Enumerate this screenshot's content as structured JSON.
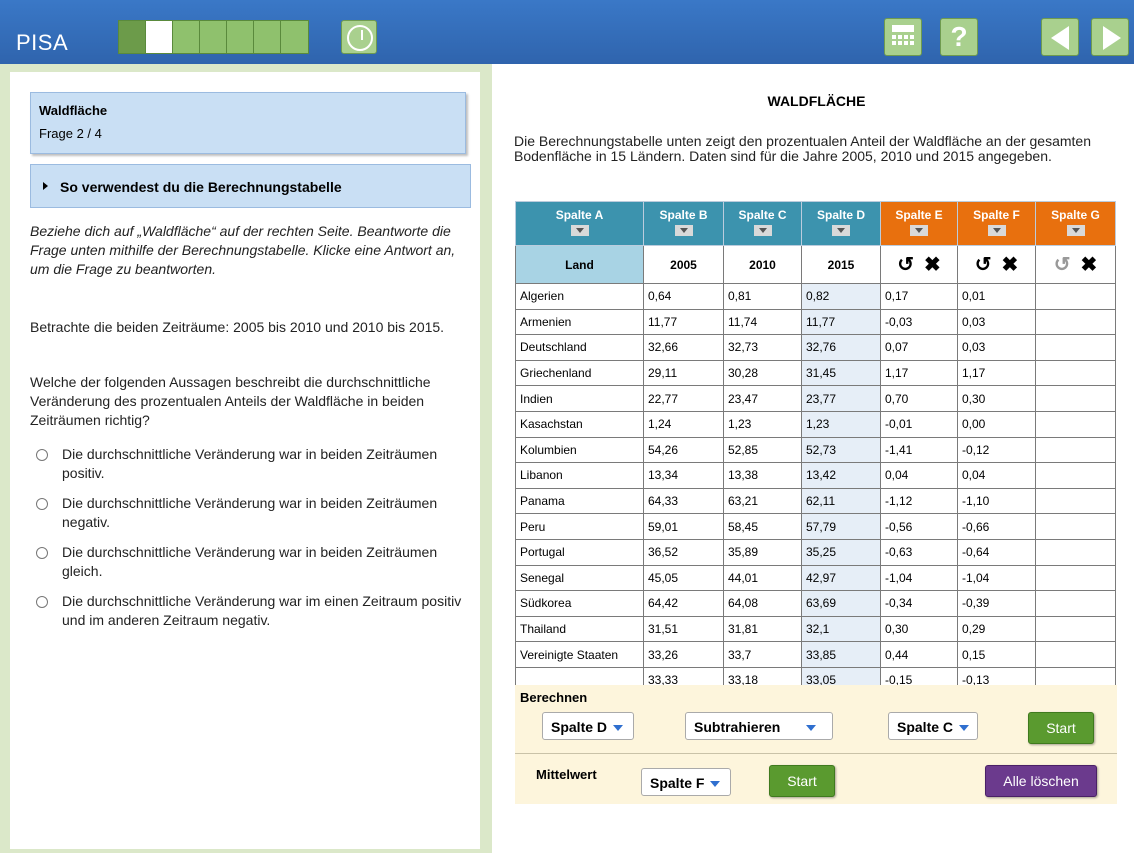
{
  "app": {
    "logo": "PISA"
  },
  "header": {
    "progress_total": 7,
    "progress_current": 2,
    "timer_icon": "clock-icon",
    "calculator_icon": "calculator-icon",
    "help_label": "?",
    "prev_icon": "arrow-left-icon",
    "next_icon": "arrow-right-icon"
  },
  "left": {
    "unit_title": "Waldfläche",
    "question_counter": "Frage 2 / 4",
    "howto_label": "So verwendest du die Berechnungstabelle",
    "instructions": "Beziehe dich auf „Waldfläche“ auf der rechten Seite. Beantworte die Frage unten mithilfe der Berechnungstabelle. Klicke eine Antwort an, um die Frage zu beantworten.",
    "context": "Betrachte die beiden Zeiträume: 2005 bis 2010 und 2010 bis 2015.",
    "question": "Welche der folgenden Aussagen beschreibt die durchschnittliche Veränderung des prozentualen Anteils der Waldfläche in beiden Zeiträumen richtig?",
    "options": [
      "Die durchschnittliche Veränderung war in beiden Zeiträumen positiv.",
      "Die durchschnittliche Veränderung war in beiden Zeiträumen negativ.",
      "Die durchschnittliche Veränderung war in beiden Zeiträumen gleich.",
      "Die durchschnittliche Veränderung war im einen Zeitraum positiv und im anderen Zeitraum negativ."
    ]
  },
  "right": {
    "title": "WALDFLÄCHE",
    "intro": "Die Berechnungstabelle unten zeigt den prozentualen Anteil der Waldfläche an der gesamten Bodenfläche in 15 Ländern. Daten sind für die Jahre 2005, 2010 und 2015 angegeben.",
    "columns": [
      "Spalte A",
      "Spalte B",
      "Spalte C",
      "Spalte D",
      "Spalte E",
      "Spalte F",
      "Spalte G"
    ],
    "subheaders": [
      "Land",
      "2005",
      "2010",
      "2015"
    ],
    "undo_icon": "↺",
    "clear_icon": "✖",
    "rows": [
      [
        "Algerien",
        "0,64",
        "0,81",
        "0,82",
        "0,17",
        "0,01",
        ""
      ],
      [
        "Armenien",
        "11,77",
        "11,74",
        "11,77",
        "-0,03",
        "0,03",
        ""
      ],
      [
        "Deutschland",
        "32,66",
        "32,73",
        "32,76",
        "0,07",
        "0,03",
        ""
      ],
      [
        "Griechenland",
        "29,11",
        "30,28",
        "31,45",
        "1,17",
        "1,17",
        ""
      ],
      [
        "Indien",
        "22,77",
        "23,47",
        "23,77",
        "0,70",
        "0,30",
        ""
      ],
      [
        "Kasachstan",
        "1,24",
        "1,23",
        "1,23",
        "-0,01",
        "0,00",
        ""
      ],
      [
        "Kolumbien",
        "54,26",
        "52,85",
        "52,73",
        "-1,41",
        "-0,12",
        ""
      ],
      [
        "Libanon",
        "13,34",
        "13,38",
        "13,42",
        "0,04",
        "0,04",
        ""
      ],
      [
        "Panama",
        "64,33",
        "63,21",
        "62,11",
        "-1,12",
        "-1,10",
        ""
      ],
      [
        "Peru",
        "59,01",
        "58,45",
        "57,79",
        "-0,56",
        "-0,66",
        ""
      ],
      [
        "Portugal",
        "36,52",
        "35,89",
        "35,25",
        "-0,63",
        "-0,64",
        ""
      ],
      [
        "Senegal",
        "45,05",
        "44,01",
        "42,97",
        "-1,04",
        "-1,04",
        ""
      ],
      [
        "Südkorea",
        "64,42",
        "64,08",
        "63,69",
        "-0,34",
        "-0,39",
        ""
      ],
      [
        "Thailand",
        "31,51",
        "31,81",
        "32,1",
        "0,30",
        "0,29",
        ""
      ],
      [
        "Vereinigte Staaten",
        "33,26",
        "33,7",
        "33,85",
        "0,44",
        "0,15",
        ""
      ],
      [
        "",
        "33,33",
        "33,18",
        "33,05",
        "-0,15",
        "-0,13",
        ""
      ]
    ],
    "calc": {
      "berechnen_label": "Berechnen",
      "operand1": "Spalte D",
      "operation": "Subtrahieren",
      "operand2": "Spalte C",
      "start_label": "Start",
      "mittelwert_label": "Mittelwert",
      "mean_column": "Spalte F",
      "start2_label": "Start",
      "clear_all_label": "Alle löschen"
    }
  }
}
